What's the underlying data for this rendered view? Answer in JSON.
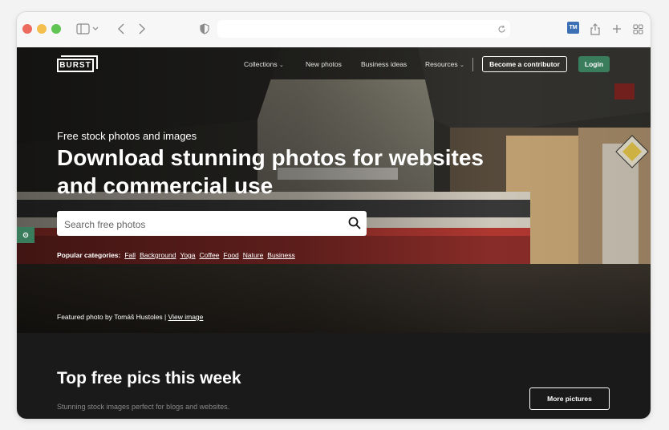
{
  "browser": {
    "traffic_lights": [
      "#ed6a5e",
      "#f5bf4f",
      "#61c554"
    ],
    "extension_badge": "TM",
    "icons": [
      "sidebar-icon",
      "back-icon",
      "forward-icon",
      "shield-icon",
      "reload-icon",
      "share-icon",
      "new-tab-icon",
      "tab-overview-icon"
    ]
  },
  "nav": {
    "logo": "BURST",
    "links": [
      {
        "label": "Collections",
        "has_dropdown": true
      },
      {
        "label": "New photos",
        "has_dropdown": false
      },
      {
        "label": "Business ideas",
        "has_dropdown": false
      },
      {
        "label": "Resources",
        "has_dropdown": true
      }
    ],
    "contributor_button": "Become a contributor",
    "login_button": "Login",
    "accent": "#3a7d5c"
  },
  "hero": {
    "subtitle": "Free stock photos and images",
    "headline": "Download stunning photos for websites and commercial use",
    "search_placeholder": "Search free photos",
    "popular_label": "Popular categories:",
    "categories": [
      "Fall",
      "Background",
      "Yoga",
      "Coffee",
      "Food",
      "Nature",
      "Business"
    ],
    "featured_prefix": "Featured photo by Tomáš Hustoles | ",
    "featured_link": "View image"
  },
  "section": {
    "title": "Top free pics this week",
    "text": "Stunning stock images perfect for blogs and websites.",
    "more_button": "More pictures"
  }
}
